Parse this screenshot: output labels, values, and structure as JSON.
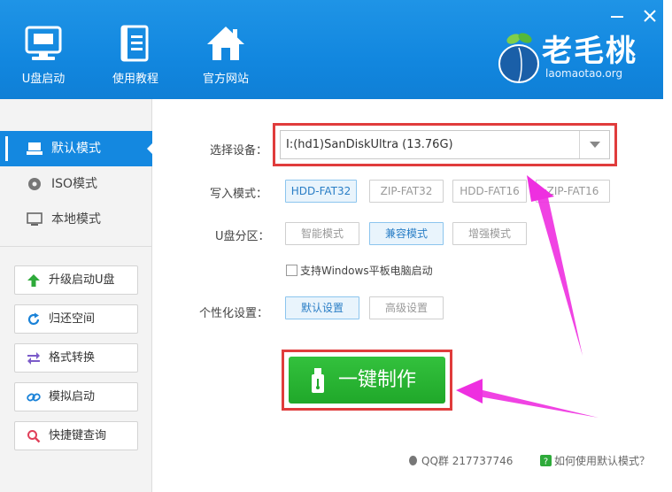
{
  "header": {
    "nav": [
      {
        "label": "U盘启动",
        "icon": "monitor-icon"
      },
      {
        "label": "使用教程",
        "icon": "book-icon"
      },
      {
        "label": "官方网站",
        "icon": "home-icon"
      }
    ],
    "logo_text": "老毛桃",
    "logo_sub": "laomaotao.org",
    "window_controls": [
      "minimize-icon",
      "close-icon"
    ]
  },
  "sidebar": {
    "modes": [
      {
        "label": "默认模式",
        "icon": "usb-drive-icon",
        "active": true
      },
      {
        "label": "ISO模式",
        "icon": "disc-icon",
        "active": false
      },
      {
        "label": "本地模式",
        "icon": "desktop-icon",
        "active": false
      }
    ],
    "tools": [
      {
        "label": "升级启动U盘",
        "icon": "arrow-up-icon",
        "color": "#2eaa3a"
      },
      {
        "label": "归还空间",
        "icon": "refresh-icon",
        "color": "#1a82d8"
      },
      {
        "label": "格式转换",
        "icon": "swap-icon",
        "color": "#7b5bc9"
      },
      {
        "label": "模拟启动",
        "icon": "link-icon",
        "color": "#1a82d8"
      },
      {
        "label": "快捷键查询",
        "icon": "search-icon",
        "color": "#e0405a"
      }
    ]
  },
  "main": {
    "device_label": "选择设备：",
    "device_value": "I:(hd1)SanDiskUltra (13.76G)",
    "write_label": "写入模式：",
    "write_modes": [
      "HDD-FAT32",
      "ZIP-FAT32",
      "HDD-FAT16",
      "ZIP-FAT16"
    ],
    "write_selected": "HDD-FAT32",
    "partition_label": "U盘分区：",
    "partition_modes": [
      "智能模式",
      "兼容模式",
      "增强模式"
    ],
    "partition_selected": "兼容模式",
    "checkbox_label": "支持Windows平板电脑启动",
    "checkbox_checked": false,
    "personal_label": "个性化设置：",
    "personal_modes": [
      "默认设置",
      "高级设置"
    ],
    "personal_selected": "默认设置",
    "make_button": "一键制作",
    "qq_text": "QQ群 217737746",
    "help_text": "如何使用默认模式？"
  },
  "colors": {
    "header_blue": "#1287df",
    "active_blue": "#1488e0",
    "make_green": "#20a82a",
    "highlight_red": "#e03c3c",
    "annotation_magenta": "#ee2fe0"
  }
}
